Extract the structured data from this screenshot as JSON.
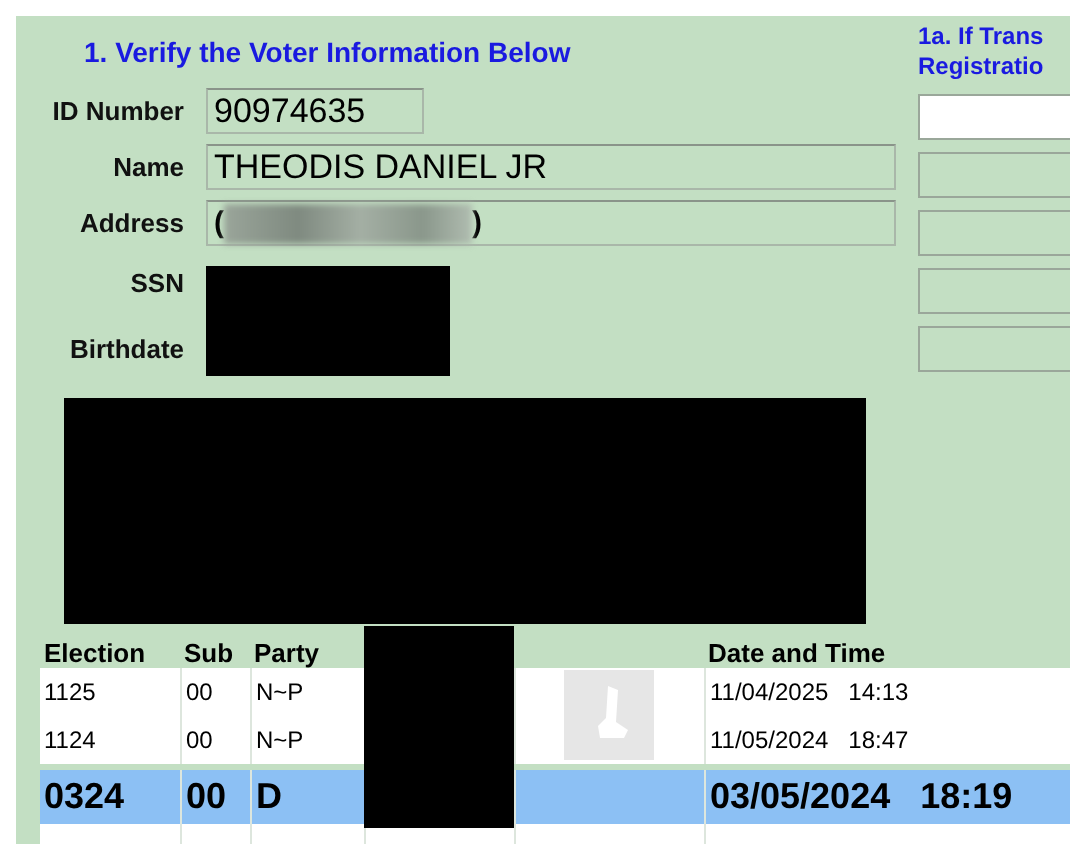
{
  "section_title": "1.  Verify the Voter Information Below",
  "fields": [
    {
      "label": "ID Number",
      "kind": "text",
      "value": "90974635"
    },
    {
      "label": "Name",
      "kind": "text",
      "value": "THEODIS DANIEL JR"
    },
    {
      "label": "Address",
      "kind": "blurred",
      "parts": [
        "(",
        ")"
      ]
    },
    {
      "label": "SSN",
      "kind": "redacted"
    },
    {
      "label": "Birthdate",
      "kind": "redacted"
    }
  ],
  "side_panel": {
    "title_lines": [
      "1a. If Trans",
      "Registratio"
    ],
    "inputs": [
      {
        "disabled": false
      },
      {
        "disabled": true
      },
      {
        "disabled": true
      },
      {
        "disabled": true
      },
      {
        "disabled": true
      }
    ]
  },
  "history": {
    "columns": [
      "Election",
      "Sub",
      "Party",
      "",
      "",
      "Date and Time"
    ],
    "rows": [
      {
        "election": "1125",
        "sub": "00",
        "party": "N~P",
        "date": "11/04/2025",
        "time": "14:13",
        "selected": false
      },
      {
        "election": "1124",
        "sub": "00",
        "party": "N~P",
        "date": "11/05/2024",
        "time": "18:47",
        "selected": false
      },
      {
        "election": "0324",
        "sub": "00",
        "party": "D",
        "date": "03/05/2024",
        "time": "18:19",
        "selected": true
      }
    ]
  }
}
